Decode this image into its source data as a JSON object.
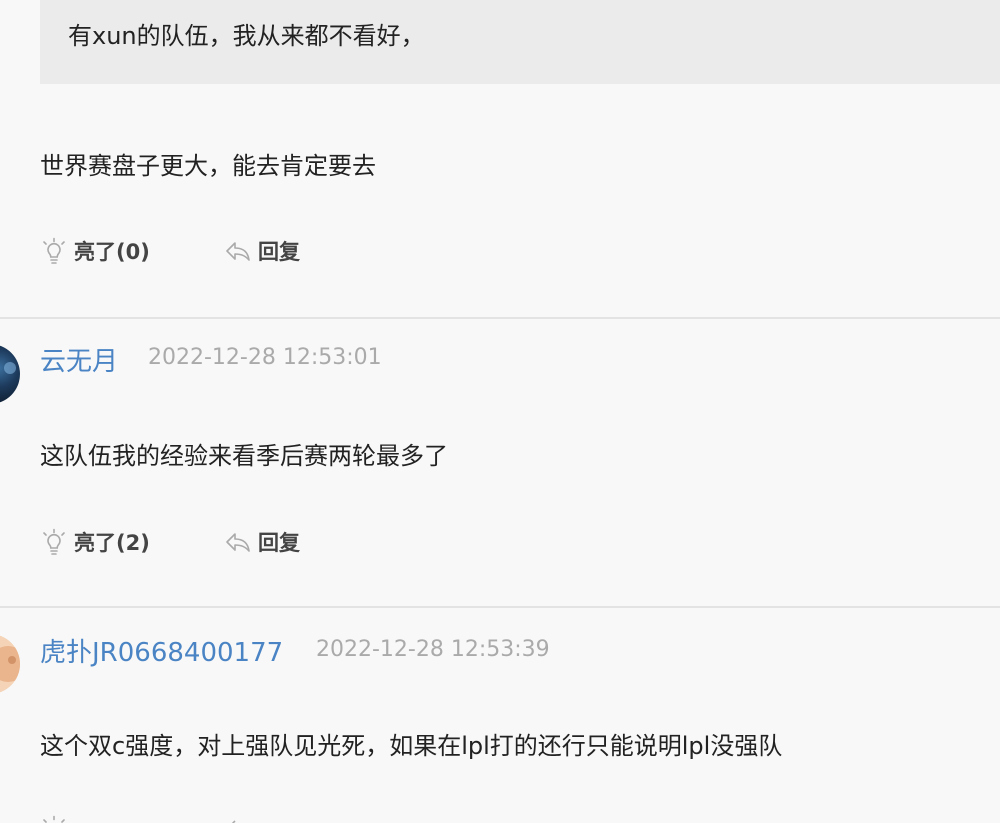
{
  "comment_1": {
    "quote": "有xun的队伍，我从来都不看好，",
    "text": "世界赛盘子更大，能去肯定要去",
    "like_label": "亮了(0)",
    "reply_label": "回复"
  },
  "comment_2": {
    "username": "云无月",
    "timestamp": "2022-12-28 12:53:01",
    "text": "这队伍我的经验来看季后赛两轮最多了",
    "like_label": "亮了(2)",
    "reply_label": "回复"
  },
  "comment_3": {
    "username": "虎扑JR0668400177",
    "timestamp": "2022-12-28 12:53:39",
    "text": "这个双c强度，对上强队见光死，如果在lpl打的还行只能说明lpl没强队"
  },
  "colors": {
    "background": "#f8f8f8",
    "quote_background": "#ebebeb",
    "username": "#4a84c4",
    "timestamp": "#aaaaaa",
    "text": "#222222",
    "divider": "#e3e3e3"
  },
  "icons": {
    "like": "lightbulb-icon",
    "reply": "reply-arrow-icon"
  }
}
